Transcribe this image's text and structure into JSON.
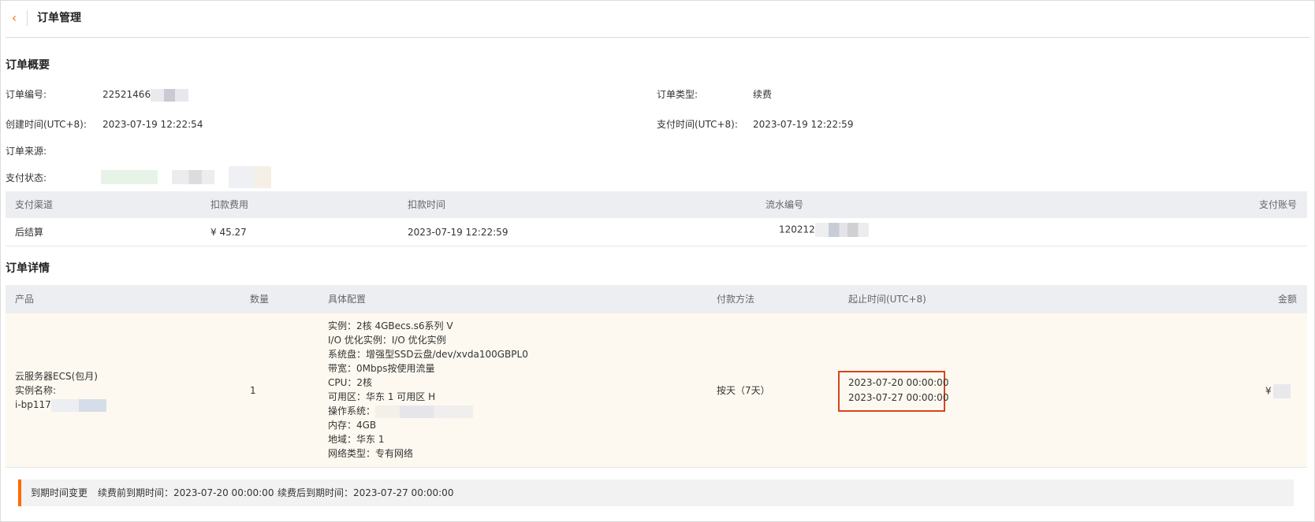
{
  "header": {
    "back_icon": "chevron-left-icon",
    "title": "订单管理",
    "accent": "#ff6a00"
  },
  "overview": {
    "title": "订单概要",
    "order_no_label": "订单编号:",
    "order_no_value": "22521466",
    "order_type_label": "订单类型:",
    "order_type_value": "续费",
    "created_label": "创建时间(UTC+8):",
    "created_value": "2023-07-19 12:22:54",
    "paid_label": "支付时间(UTC+8):",
    "paid_value": "2023-07-19 12:22:59",
    "source_label": "订单来源:",
    "status_label": "支付状态:"
  },
  "payment_table": {
    "headers": [
      "支付渠道",
      "扣款费用",
      "扣款时间",
      "流水编号",
      "支付账号"
    ],
    "row": {
      "channel": "后结算",
      "amount": "¥ 45.27",
      "time": "2023-07-19 12:22:59",
      "serial": "120212"
    }
  },
  "detail": {
    "title": "订单详情",
    "headers": [
      "产品",
      "数量",
      "具体配置",
      "付款方法",
      "起止时间(UTC+8)",
      "金额"
    ],
    "product_name": "云服务器ECS(包月)",
    "instance_label": "实例名称:",
    "instance_id": "i-bp117",
    "quantity": "1",
    "config": [
      "实例：2核 4GBecs.s6系列 V",
      "I/O 优化实例：I/O 优化实例",
      "系统盘：增强型SSD云盘/dev/xvda100GBPL0",
      "带宽：0Mbps按使用流量",
      "CPU：2核",
      "可用区：华东 1 可用区 H",
      "操作系统：",
      "内存：4GB",
      "地域：华东 1",
      "网络类型：专有网络"
    ],
    "payment_method": "按天（7天）",
    "start_time": "2023-07-20 00:00:00",
    "end_time": "2023-07-27 00:00:00",
    "amount": "¥",
    "highlight_color": "#d9431c"
  },
  "notice": {
    "title": "到期时间变更",
    "before_label": "续费前到期时间：",
    "before_value": "2023-07-20 00:00:00",
    "after_label": "续费后到期时间：",
    "after_value": "2023-07-27 00:00:00"
  }
}
